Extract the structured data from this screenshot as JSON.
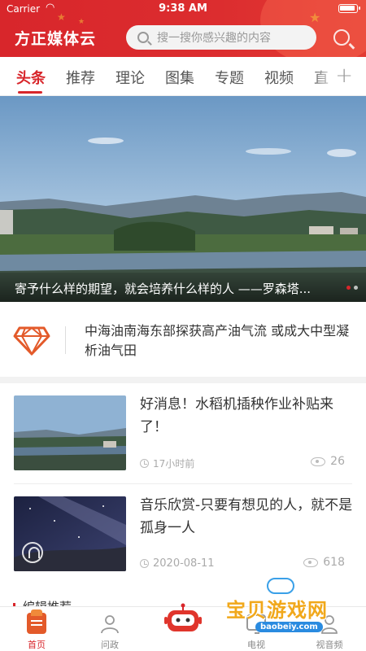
{
  "status_bar": {
    "carrier": "Carrier",
    "time": "9:38 AM"
  },
  "header": {
    "app_title": "方正媒体云",
    "search_placeholder": "搜一搜你感兴趣的内容"
  },
  "tabs": [
    {
      "label": "头条",
      "active": true
    },
    {
      "label": "推荐"
    },
    {
      "label": "理论"
    },
    {
      "label": "图集"
    },
    {
      "label": "专题"
    },
    {
      "label": "视频"
    },
    {
      "label": "直"
    }
  ],
  "tab_add_label": "+",
  "banner": {
    "caption": "寄予什么样的期望，就会培养什么样的人 ——罗森塔..."
  },
  "headline": {
    "text": "中海油南海东部探获高产油气流 或成大中型凝析油气田"
  },
  "news": [
    {
      "title": "好消息！水稻机插秧作业补贴来了！",
      "time": "17小时前",
      "views": "26"
    },
    {
      "title": "音乐欣赏-只要有想见的人，就不是孤身一人",
      "time": "2020-08-11",
      "views": "618"
    }
  ],
  "section": {
    "label": "编辑推荐"
  },
  "bottom_nav": [
    {
      "label": "首页",
      "icon": "home-icon",
      "active": true
    },
    {
      "label": "问政",
      "icon": "people-icon"
    },
    {
      "label": "",
      "icon": "robot-icon"
    },
    {
      "label": "电视",
      "icon": "tv-icon"
    },
    {
      "label": "视音频",
      "icon": "person-icon"
    }
  ],
  "watermark": {
    "text": "宝贝游戏网",
    "url": "baobeiy.com"
  },
  "colors": {
    "brand_red": "#d8262b",
    "accent_orange": "#e35a2a"
  }
}
